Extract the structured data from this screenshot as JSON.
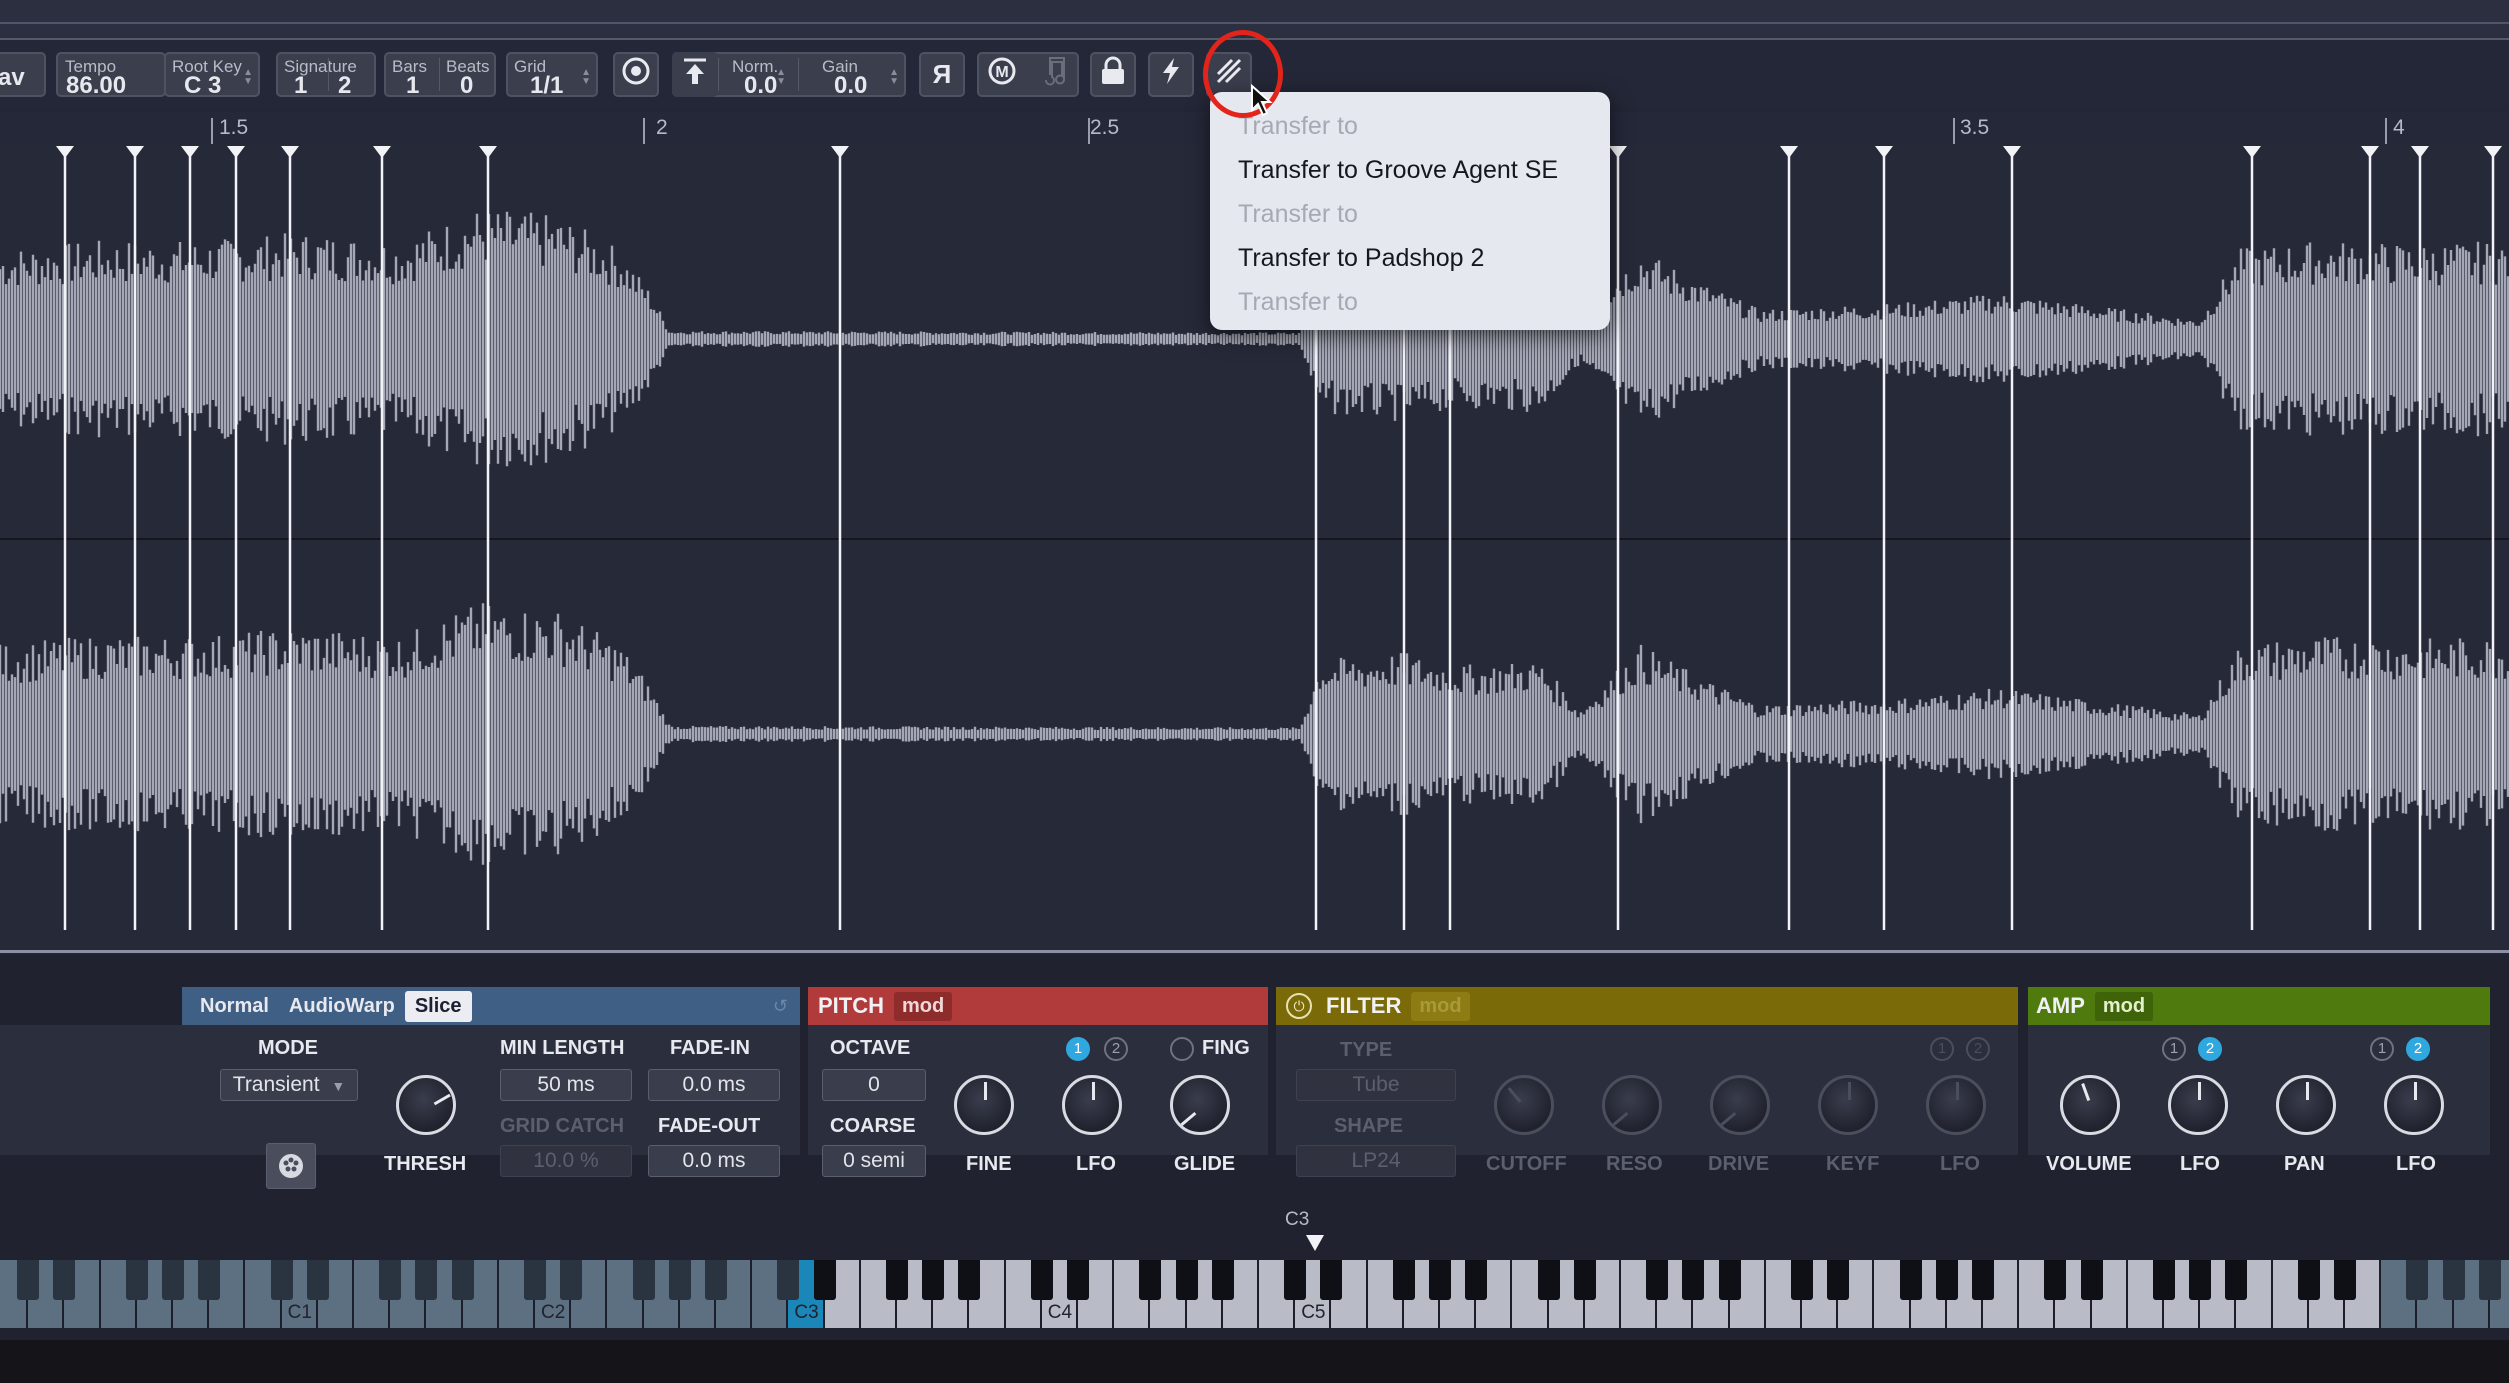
{
  "toolbar": {
    "left_fragment": "av",
    "tempo": {
      "label": "Tempo",
      "value": "86.00"
    },
    "root_key": {
      "label": "Root Key",
      "value": "C 3"
    },
    "signature": {
      "label": "Signature",
      "num": "1",
      "den": "2"
    },
    "bars": {
      "label": "Bars",
      "value": "1"
    },
    "beats": {
      "label": "Beats",
      "value": "0"
    },
    "grid": {
      "label": "Grid",
      "value": "1/1"
    },
    "norm": {
      "label": "Norm.",
      "value": "0.0"
    },
    "gain": {
      "label": "Gain",
      "value": "0.0"
    },
    "reverse_glyph": "Я",
    "icons": [
      "target-icon",
      "normalize-icon",
      "reverse-icon",
      "metronome-icon",
      "note-icon",
      "lock-icon",
      "bolt-icon",
      "transfer-icon"
    ]
  },
  "ruler": {
    "labels": [
      "1.5",
      "2",
      "2.5",
      "3.5",
      "4"
    ]
  },
  "context_menu": {
    "items": [
      {
        "label": "Transfer to",
        "enabled": false
      },
      {
        "label": "Transfer to Groove Agent SE",
        "enabled": true
      },
      {
        "label": "Transfer to",
        "enabled": false
      },
      {
        "label": "Transfer to Padshop 2",
        "enabled": true
      },
      {
        "label": "Transfer to",
        "enabled": false
      }
    ]
  },
  "playback": {
    "modes": [
      "Normal",
      "AudioWarp",
      "Slice"
    ],
    "active_mode": "Slice",
    "mode_label": "MODE",
    "mode_value": "Transient",
    "thresh_label": "THRESH",
    "min_length_label": "MIN LENGTH",
    "min_length_value": "50 ms",
    "grid_catch_label": "GRID CATCH",
    "grid_catch_value": "10.0 %",
    "fade_in_label": "FADE-IN",
    "fade_in_value": "0.0 ms",
    "fade_out_label": "FADE-OUT",
    "fade_out_value": "0.0 ms"
  },
  "pitch": {
    "title": "PITCH",
    "mod": "mod",
    "octave_label": "OCTAVE",
    "octave_value": "0",
    "coarse_label": "COARSE",
    "coarse_value": "0 semi",
    "fine_label": "FINE",
    "lfo_label": "LFO",
    "glide_label": "GLIDE",
    "fing_label": "FING",
    "lfo_badges": [
      "1",
      "2"
    ]
  },
  "filter": {
    "title": "FILTER",
    "mod": "mod",
    "type_label": "TYPE",
    "type_value": "Tube",
    "shape_label": "SHAPE",
    "shape_value": "LP24",
    "knobs": [
      "CUTOFF",
      "RESO",
      "DRIVE",
      "KEYF",
      "LFO"
    ],
    "lfo_badges": [
      "1",
      "2"
    ]
  },
  "amp": {
    "title": "AMP",
    "mod": "mod",
    "volume_label": "VOLUME",
    "lfo1_label": "LFO",
    "pan_label": "PAN",
    "lfo2_label": "LFO",
    "lfo_badges": [
      "1",
      "2"
    ]
  },
  "keyboard": {
    "root_marker": "C3",
    "octave_labels": [
      "C1",
      "C2",
      "C3",
      "C4",
      "C5"
    ]
  },
  "colors": {
    "pitch": "#b13b3b",
    "filter": "#7a6a08",
    "amp": "#4f7a0e",
    "playback": "#3f5f85",
    "highlight_ring": "#e3241b",
    "lfo_active": "#2fa7df"
  }
}
